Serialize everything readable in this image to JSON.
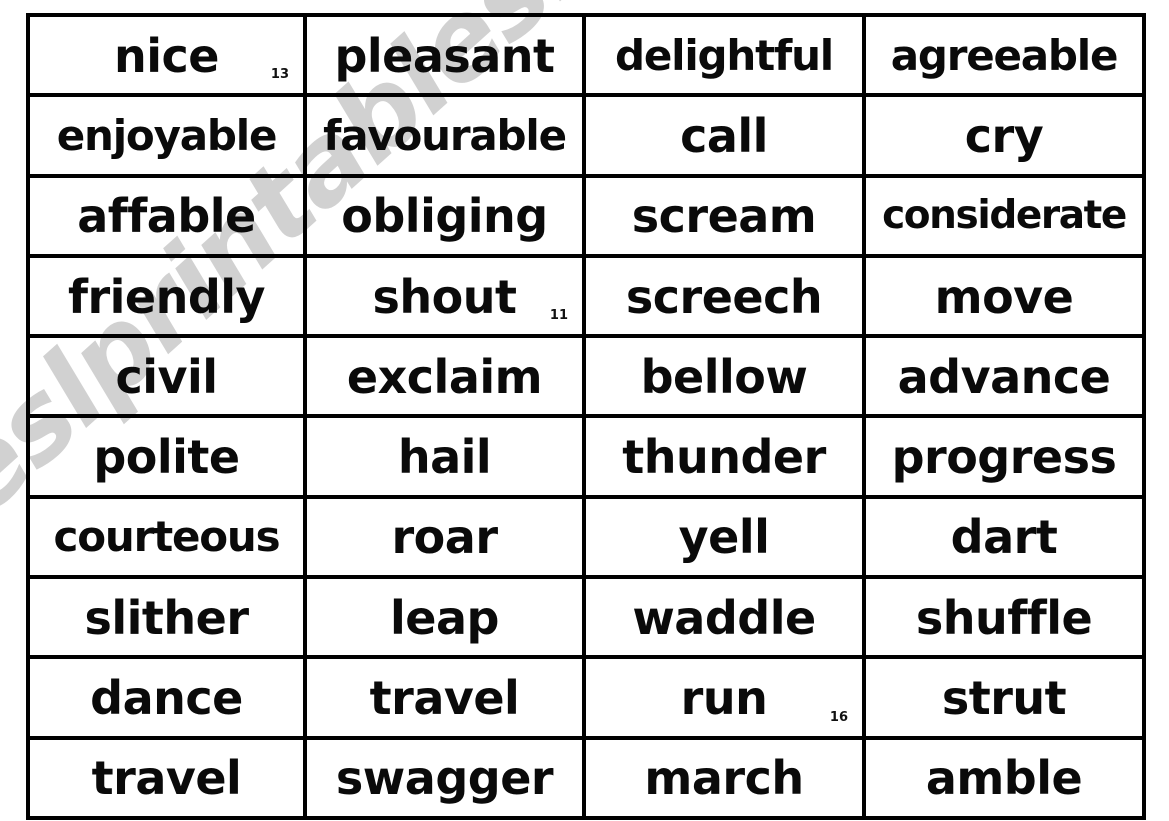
{
  "document": {
    "type": "word-card-worksheet",
    "watermark_text": "eslprintables.com",
    "background_color": "#ffffff",
    "ink_color": "#0a0a0a",
    "watermark_color": "#c9c9c9"
  },
  "table": {
    "rows": 10,
    "columns": 4,
    "cells": [
      [
        {
          "word": "nice",
          "marker": "13"
        },
        {
          "word": "pleasant",
          "marker": ""
        },
        {
          "word": "delightful",
          "marker": ""
        },
        {
          "word": "agreeable",
          "marker": ""
        }
      ],
      [
        {
          "word": "enjoyable",
          "marker": ""
        },
        {
          "word": "favourable",
          "marker": ""
        },
        {
          "word": "call",
          "marker": ""
        },
        {
          "word": "cry",
          "marker": ""
        }
      ],
      [
        {
          "word": "affable",
          "marker": ""
        },
        {
          "word": "obliging",
          "marker": ""
        },
        {
          "word": "scream",
          "marker": ""
        },
        {
          "word": "considerate",
          "marker": ""
        }
      ],
      [
        {
          "word": "friendly",
          "marker": ""
        },
        {
          "word": "shout",
          "marker": "11"
        },
        {
          "word": "screech",
          "marker": ""
        },
        {
          "word": "move",
          "marker": ""
        }
      ],
      [
        {
          "word": "civil",
          "marker": ""
        },
        {
          "word": "exclaim",
          "marker": ""
        },
        {
          "word": "bellow",
          "marker": ""
        },
        {
          "word": "advance",
          "marker": ""
        }
      ],
      [
        {
          "word": "polite",
          "marker": ""
        },
        {
          "word": "hail",
          "marker": ""
        },
        {
          "word": "thunder",
          "marker": ""
        },
        {
          "word": "progress",
          "marker": ""
        }
      ],
      [
        {
          "word": "courteous",
          "marker": ""
        },
        {
          "word": "roar",
          "marker": ""
        },
        {
          "word": "yell",
          "marker": ""
        },
        {
          "word": "dart",
          "marker": ""
        }
      ],
      [
        {
          "word": "slither",
          "marker": ""
        },
        {
          "word": "leap",
          "marker": ""
        },
        {
          "word": "waddle",
          "marker": ""
        },
        {
          "word": "shuffle",
          "marker": ""
        }
      ],
      [
        {
          "word": "dance",
          "marker": ""
        },
        {
          "word": "travel",
          "marker": ""
        },
        {
          "word": "run",
          "marker": "16"
        },
        {
          "word": "strut",
          "marker": ""
        }
      ],
      [
        {
          "word": "travel",
          "marker": ""
        },
        {
          "word": "swagger",
          "marker": ""
        },
        {
          "word": "march",
          "marker": ""
        },
        {
          "word": "amble",
          "marker": ""
        }
      ]
    ]
  }
}
